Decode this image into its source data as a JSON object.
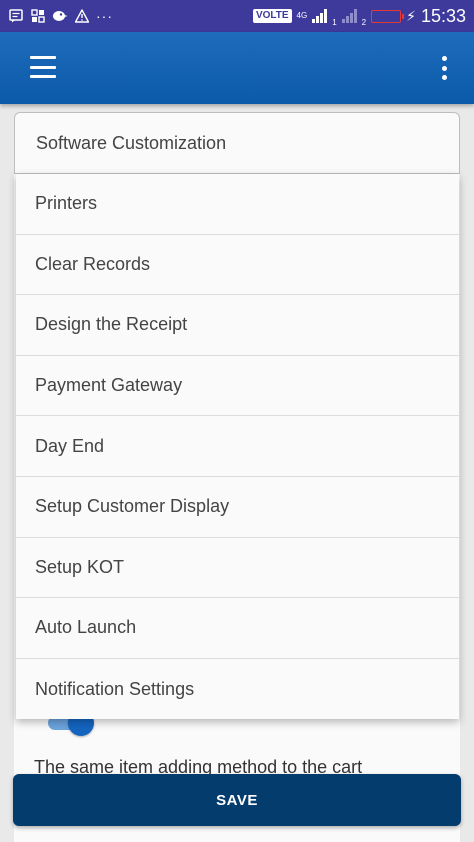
{
  "status_bar": {
    "network_label": "VOLTE",
    "sim1_index": "1",
    "network_type": "4G",
    "sim2_index": "2",
    "time": "15:33",
    "notification_icons": [
      "message-icon",
      "grid-app-icon",
      "bird-app-icon",
      "warning-icon",
      "more-icon"
    ],
    "battery_color": "#e53935"
  },
  "app_bar": {
    "background_color": "#0b5aa9",
    "menu_icon": "hamburger-icon",
    "overflow_icon": "overflow-menu-icon"
  },
  "dropdown": {
    "selected": "Software Customization",
    "items": [
      "Printers",
      "Clear Records",
      "Design the Receipt",
      "Payment Gateway",
      "Day End",
      "Setup Customer Display",
      "Setup KOT",
      "Auto Launch",
      "Notification Settings"
    ]
  },
  "background": {
    "toggle_on": true,
    "text": "The same item adding method to the cart"
  },
  "save_button": {
    "label": "SAVE",
    "color": "#053c6e"
  }
}
